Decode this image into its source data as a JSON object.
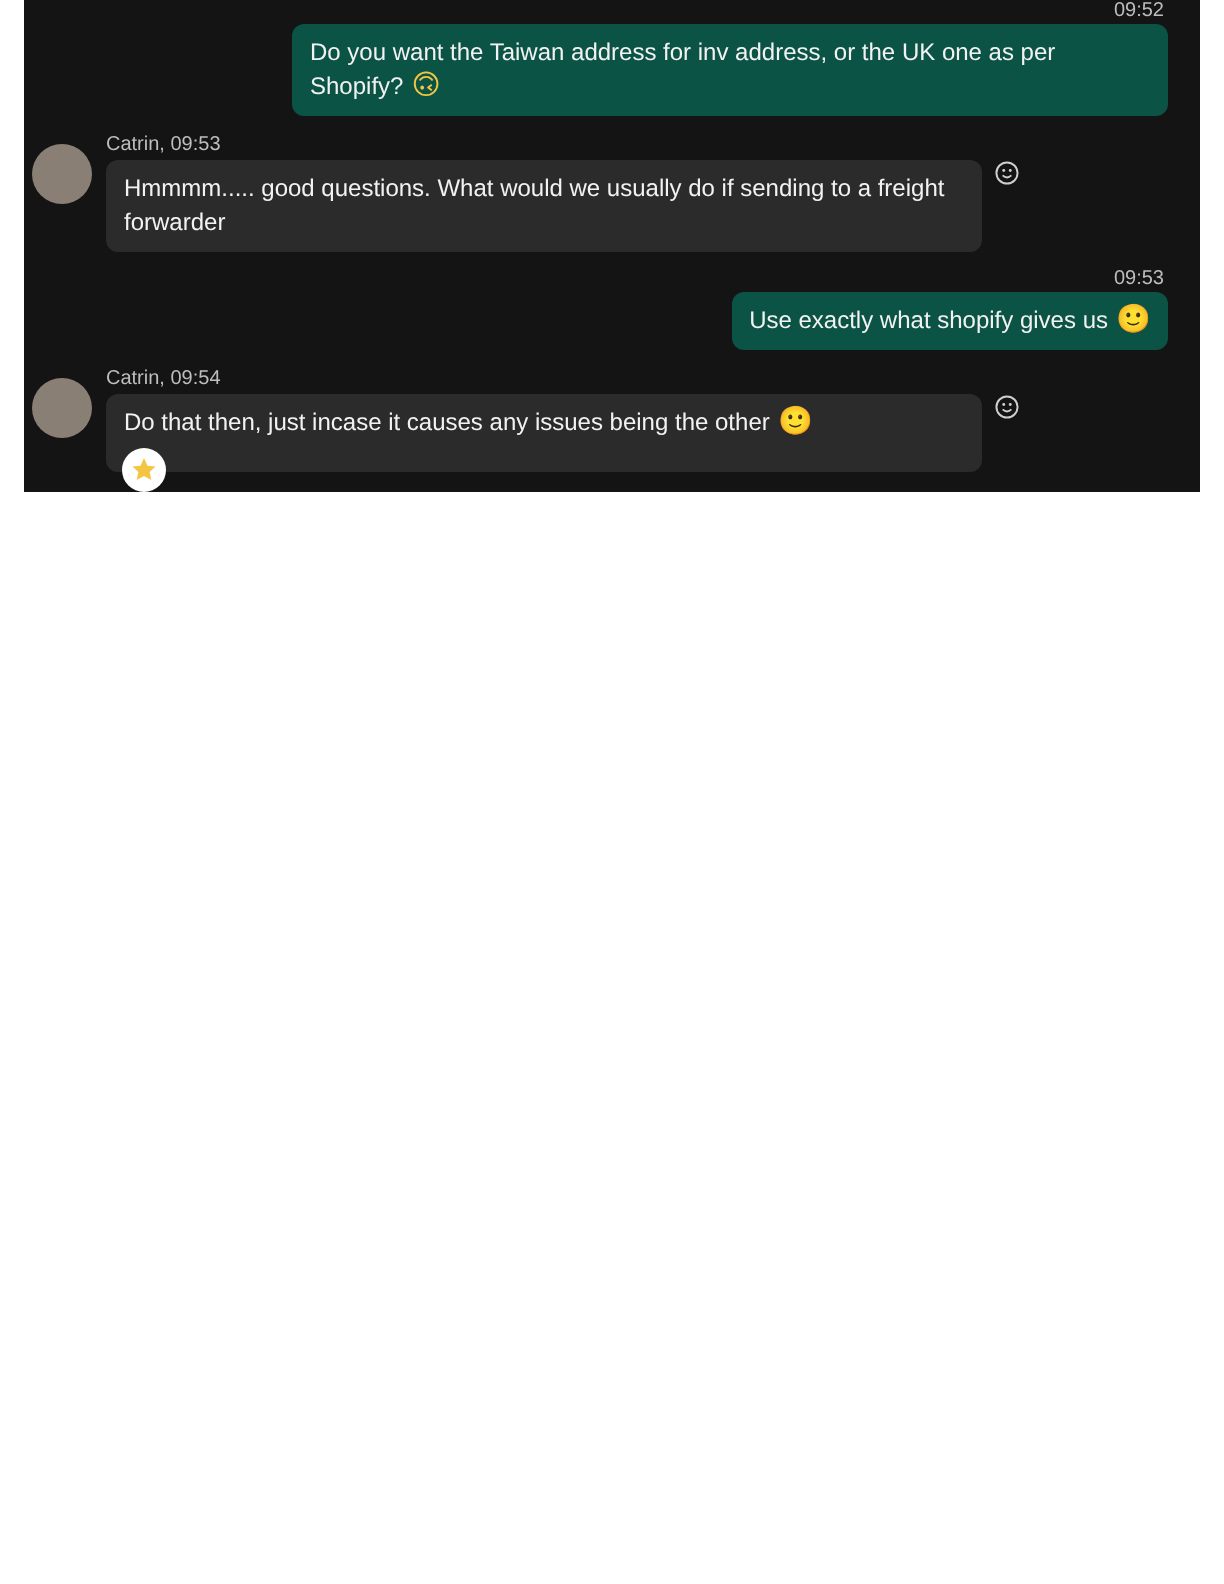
{
  "messages": [
    {
      "kind": "sent",
      "time": "09:52",
      "text": "Do you want the Taiwan address for inv address, or the UK one as per Shopify?",
      "emoji": "🙃"
    },
    {
      "kind": "received",
      "sender": "Catrin, 09:53",
      "text": "Hmmmm..... good questions. What would we usually do if sending to a freight forwarder",
      "reaction": false
    },
    {
      "kind": "sent",
      "time": "09:53",
      "text": "Use exactly what shopify gives us",
      "emoji": "🙂"
    },
    {
      "kind": "received",
      "sender": "Catrin, 09:54",
      "text": "Do that then, just incase it causes any issues being the other",
      "emoji": "🙂",
      "reaction": true
    }
  ]
}
